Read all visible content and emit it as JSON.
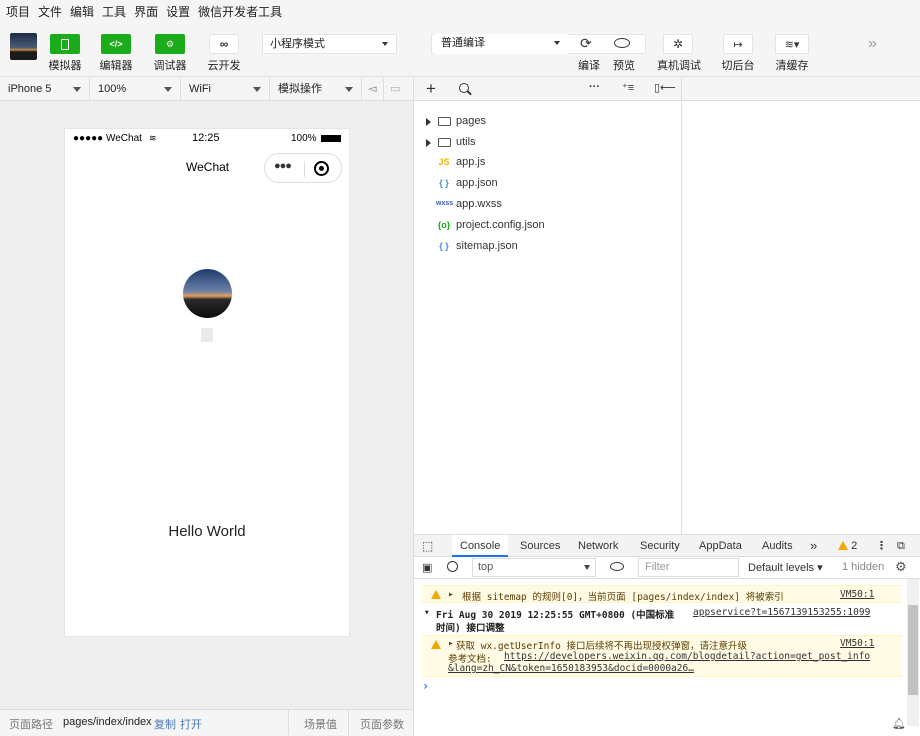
{
  "menu": [
    "项目",
    "文件",
    "编辑",
    "工具",
    "界面",
    "设置",
    "微信开发者工具"
  ],
  "toolbar": {
    "simulator_label": "模拟器",
    "editor_label": "编辑器",
    "debugger_label": "调试器",
    "cloud_label": "云开发",
    "mode_select": "小程序模式",
    "compile_select": "普通编译",
    "compile_label": "编译",
    "preview_label": "预览",
    "remote_debug_label": "真机调试",
    "background_label": "切后台",
    "clear_cache_label": "清缓存",
    "more": "»"
  },
  "devbar": {
    "device": "iPhone 5",
    "zoom": "100%",
    "network": "WiFi",
    "ops": "模拟操作"
  },
  "phone": {
    "carrier": "●●●●● WeChat",
    "time": "12:25",
    "battery": "100%",
    "nav_title": "WeChat",
    "hello": "Hello World"
  },
  "footer": {
    "path_label": "页面路径",
    "path": "pages/index/index",
    "copy": "复制",
    "open": "打开",
    "scene": "场景值",
    "params": "页面参数"
  },
  "files": [
    {
      "name": "pages",
      "icon": "folder",
      "folder": true
    },
    {
      "name": "utils",
      "icon": "folder",
      "folder": true
    },
    {
      "name": "app.js",
      "icon": "JS",
      "color": "#f0b400"
    },
    {
      "name": "app.json",
      "icon": "{ }",
      "color": "#3b8be6"
    },
    {
      "name": "app.wxss",
      "icon": "wxss",
      "color": "#3b5fc0"
    },
    {
      "name": "project.config.json",
      "icon": "{o}",
      "color": "#1aad19"
    },
    {
      "name": "sitemap.json",
      "icon": "{ }",
      "color": "#3b8be6"
    }
  ],
  "devtools": {
    "tabs": [
      "Console",
      "Sources",
      "Network",
      "Security",
      "AppData",
      "Audits"
    ],
    "more": "»",
    "warn_count": "2",
    "context": "top",
    "filter_placeholder": "Filter",
    "levels": "Default levels",
    "hidden": "1 hidden"
  },
  "console": {
    "line1_text": "根据 sitemap 的规则[0]，当前页面 [pages/index/index] 将被索引",
    "line1_src": "VM50:1",
    "group_text": "Fri Aug 30 2019 12:25:55 GMT+0800 (中国标准",
    "group_src": "appservice?t=1567139153255:1099",
    "group_text2": "时间) 接口调整",
    "line2_text": "获取 wx.getUserInfo 接口后续将不再出现授权弹窗，请注意升级",
    "line2_src": "VM50:1",
    "line2_doc": "参考文档:",
    "line2_url": "https://developers.weixin.qq.com/blogdetail?action=get_post_info",
    "line2_url2": "&lang=zh_CN&token=1650183953&docid=0000a26…",
    "prompt": "›"
  },
  "colors": {
    "brand_green": "#1aad19",
    "warn_bg": "#fffbe5"
  }
}
